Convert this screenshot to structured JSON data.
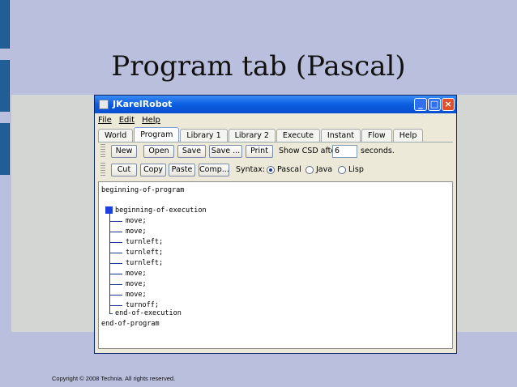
{
  "slide": {
    "title": "Program tab (Pascal)",
    "copyright": "Copyright © 2008  Technia. All rights reserved."
  },
  "window": {
    "title": "JKarelRobot",
    "menu": [
      "File",
      "Edit",
      "Help"
    ],
    "tabs": [
      "World",
      "Program",
      "Library 1",
      "Library 2",
      "Execute",
      "Instant",
      "Flow",
      "Help"
    ],
    "active_tab": "Program",
    "toolbar": {
      "new": "New",
      "open": "Open",
      "save": "Save",
      "save_as": "Save ...",
      "print": "Print",
      "show_csd_label": "Show CSD after",
      "csd_seconds_value": "6",
      "seconds_label": "seconds.",
      "cut": "Cut",
      "copy": "Copy",
      "paste": "Paste",
      "compile": "Comp...",
      "syntax_label": "Syntax:",
      "syntax_options": [
        "Pascal",
        "Java",
        "Lisp"
      ],
      "syntax_selected": "Pascal"
    },
    "code": [
      "beginning-of-program",
      "beginning-of-execution",
      "move;",
      "move;",
      "turnleft;",
      "turnleft;",
      "turnleft;",
      "move;",
      "move;",
      "move;",
      "turnoff;",
      "end-of-execution",
      "end-of-program"
    ]
  }
}
